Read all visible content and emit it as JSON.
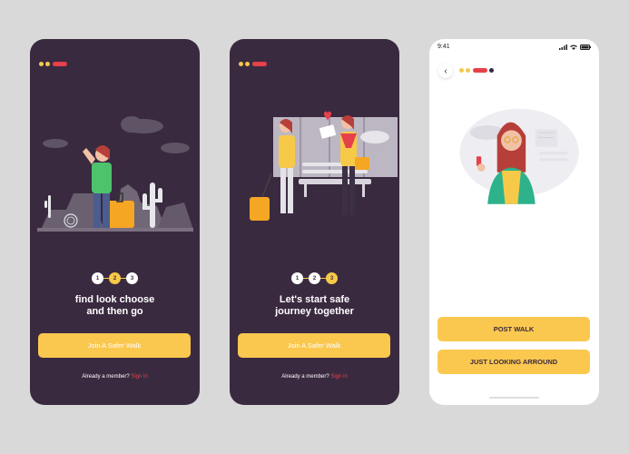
{
  "colors": {
    "background": "#d9d9d9",
    "dark": "#3a2a40",
    "accent": "#f7c948",
    "button": "#fbc84f",
    "red": "#e5414a"
  },
  "screen1": {
    "steps": [
      "1",
      "2",
      "3"
    ],
    "active_step": 2,
    "headline_line1": "find look choose",
    "headline_line2": "and then go",
    "button": "Join A Safer Walk",
    "member_text": "Already a member?",
    "signin": "Sign in"
  },
  "screen2": {
    "steps": [
      "1",
      "2",
      "3"
    ],
    "active_step": 3,
    "headline_line1": "Let's start safe",
    "headline_line2": "journey together",
    "button": "Join A Safer Walk",
    "member_text": "Already a member?",
    "signin": "Sign in"
  },
  "screen3": {
    "time": "9:41",
    "back_icon": "chevron-left-icon",
    "post_button": "POST WALK",
    "look_button": "JUST LOOKING ARROUND"
  }
}
